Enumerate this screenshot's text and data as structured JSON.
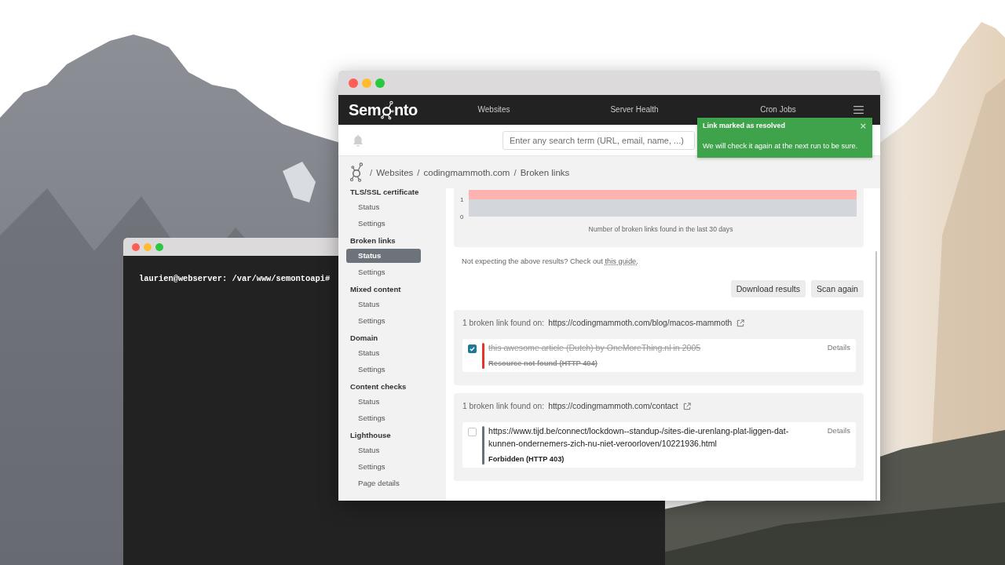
{
  "desktop": {
    "terminal": {
      "prompt": "laurien@webserver: /var/www/semontoapi#"
    }
  },
  "app": {
    "navbar": {
      "logo": {
        "prefix": "Sem",
        "suffix": "nto"
      },
      "links": [
        {
          "label": "Websites"
        },
        {
          "label": "Server Health"
        },
        {
          "label": "Cron Jobs"
        }
      ]
    },
    "header": {
      "search": {
        "placeholder": "Enter any search term (URL, email, name, ...)"
      }
    },
    "toast": {
      "title": "Link marked as resolved",
      "close": "×",
      "message": "We will check it again at the next run to be sure."
    },
    "breadcrumb": [
      {
        "separator": "/",
        "label": "Websites"
      },
      {
        "separator": "/",
        "label": "codingmammoth.com"
      },
      {
        "separator": "/",
        "label": "Broken links"
      }
    ],
    "sidebar": {
      "sections": [
        {
          "title": "TLS/SSL certificate",
          "items": [
            {
              "label": "Status",
              "selected": false
            },
            {
              "label": "Settings",
              "selected": false
            }
          ]
        },
        {
          "title": "Broken links",
          "items": [
            {
              "label": "Status",
              "selected": true
            },
            {
              "label": "Settings",
              "selected": false
            }
          ]
        },
        {
          "title": "Mixed content",
          "items": [
            {
              "label": "Status",
              "selected": false
            },
            {
              "label": "Settings",
              "selected": false
            }
          ]
        },
        {
          "title": "Domain",
          "items": [
            {
              "label": "Status",
              "selected": false
            },
            {
              "label": "Settings",
              "selected": false
            }
          ]
        },
        {
          "title": "Content checks",
          "items": [
            {
              "label": "Status",
              "selected": false
            },
            {
              "label": "Settings",
              "selected": false
            }
          ]
        },
        {
          "title": "Lighthouse",
          "items": [
            {
              "label": "Status",
              "selected": false
            },
            {
              "label": "Settings",
              "selected": false
            },
            {
              "label": "Page details",
              "selected": false
            }
          ]
        }
      ]
    },
    "main": {
      "chart_card": {
        "axis_labels": [
          "1",
          "0"
        ],
        "caption": "Number of broken links found in the last 30 days"
      },
      "note": {
        "text": "Not expecting the above results? Check out",
        "link": "this guide."
      },
      "actions": [
        {
          "label": "Download results"
        },
        {
          "label": "Scan again"
        }
      ],
      "results": [
        {
          "summary": "1 broken link found on:",
          "page_url": "https://codingmammoth.com/blog/macos-mammoth",
          "links": [
            {
              "checked": true,
              "color": "#e8322b",
              "text": "this awesome article (Dutch) by OneMoreThing.nl in 2005",
              "status": "Resource not found (HTTP 404)",
              "details": "Details"
            }
          ]
        },
        {
          "summary": "1 broken link found on:",
          "page_url": "https://codingmammoth.com/contact",
          "links": [
            {
              "checked": false,
              "color": "#6b7078",
              "text": "https://www.tijd.be/connect/lockdown--standup-/sites-die-urenlang-plat-liggen-dat-kunnen-ondernemers-zich-nu-niet-veroorloven/10221936.html",
              "status": "Forbidden (HTTP 403)",
              "details": "Details"
            }
          ]
        }
      ]
    }
  }
}
